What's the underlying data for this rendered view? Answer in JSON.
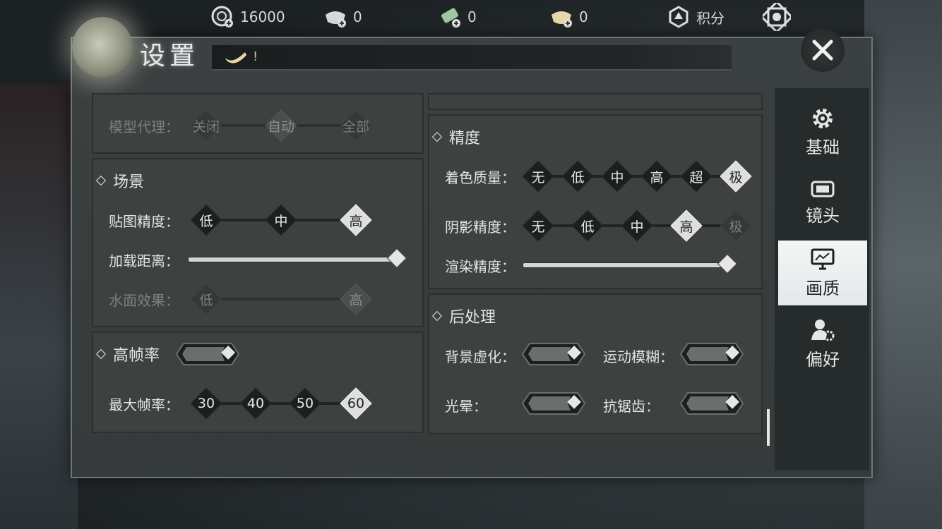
{
  "currencies": [
    {
      "icon": "coin-icon",
      "value": "16000"
    },
    {
      "icon": "silver-ingot-icon",
      "value": "0"
    },
    {
      "icon": "jade-icon",
      "value": "0"
    },
    {
      "icon": "gold-ingot-icon",
      "value": "0"
    }
  ],
  "points": {
    "label": "积分"
  },
  "header": {
    "title": "设置",
    "note": "!"
  },
  "sections": {
    "model_proxy": {
      "label": "模型代理：",
      "options": [
        "关闭",
        "自动",
        "全部"
      ]
    },
    "scene": {
      "title": "场景",
      "texture": {
        "label": "贴图精度：",
        "options": [
          "低",
          "中",
          "高"
        ],
        "selected": "高"
      },
      "load_distance": {
        "label": "加载距离：",
        "value": 1.0
      },
      "water": {
        "label": "水面效果：",
        "options": [
          "低",
          "高"
        ],
        "selected": "高"
      }
    },
    "high_fps": {
      "title": "高帧率",
      "enabled": true,
      "max_fps": {
        "label": "最大帧率：",
        "options": [
          "30",
          "40",
          "50",
          "60"
        ],
        "selected": "60"
      }
    },
    "precision": {
      "title": "精度",
      "shading": {
        "label": "着色质量：",
        "options": [
          "无",
          "低",
          "中",
          "高",
          "超",
          "极"
        ],
        "selected": "极"
      },
      "shadow": {
        "label": "阴影精度：",
        "options": [
          "无",
          "低",
          "中",
          "高",
          "极"
        ],
        "selected": "高"
      },
      "render": {
        "label": "渲染精度：",
        "value": 1.0
      }
    },
    "post": {
      "title": "后处理",
      "bg_blur": {
        "label": "背景虚化：",
        "enabled": true
      },
      "motion_blur": {
        "label": "运动模糊：",
        "enabled": true
      },
      "bloom": {
        "label": "光晕：",
        "enabled": true
      },
      "aa": {
        "label": "抗锯齿：",
        "enabled": true
      }
    }
  },
  "sidebar": {
    "items": [
      {
        "label": "基础",
        "icon": "gear-icon"
      },
      {
        "label": "镜头",
        "icon": "camera-icon"
      },
      {
        "label": "画质",
        "icon": "monitor-icon",
        "active": true
      },
      {
        "label": "偏好",
        "icon": "user-gear-icon"
      }
    ]
  },
  "colors": {
    "accent": "#e3e8e8",
    "panel": "#3d4241",
    "dark": "#1c1f20"
  }
}
